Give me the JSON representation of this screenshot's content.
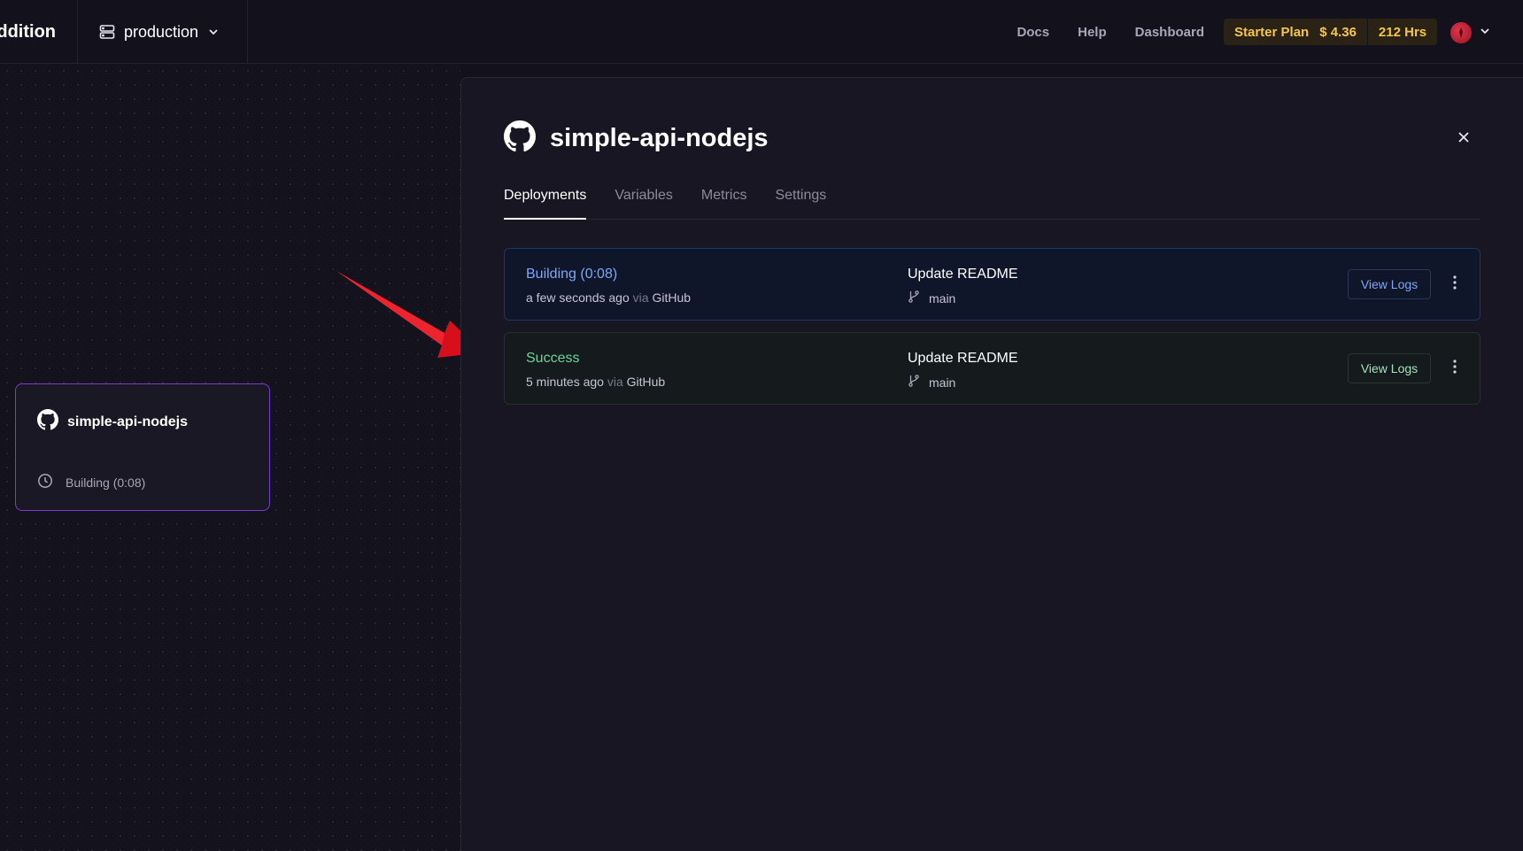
{
  "topbar": {
    "project_name": "addition",
    "environment": "production",
    "nav": [
      "Docs",
      "Help",
      "Dashboard"
    ],
    "plan": {
      "name": "Starter Plan",
      "cost": "$ 4.36",
      "hours": "212 Hrs",
      "color": "#f5c64a"
    }
  },
  "canvas": {
    "service": {
      "name": "simple-api-nodejs",
      "status": "Building (0:08)",
      "icon": "github-icon",
      "border_color": "#7b3bd0"
    },
    "arrow_color": "#e0101a"
  },
  "panel": {
    "title": "simple-api-nodejs",
    "icon": "github-icon",
    "tabs": [
      {
        "label": "Deployments",
        "active": true
      },
      {
        "label": "Variables",
        "active": false
      },
      {
        "label": "Metrics",
        "active": false
      },
      {
        "label": "Settings",
        "active": false
      }
    ],
    "deployments": [
      {
        "status": "Building (0:08)",
        "time": "a few seconds ago",
        "via": "via",
        "source": "GitHub",
        "commit": "Update README",
        "branch": "main",
        "logs_label": "View Logs",
        "status_color": "#7ea6f5"
      },
      {
        "status": "Success",
        "time": "5 minutes ago",
        "via": "via",
        "source": "GitHub",
        "commit": "Update README",
        "branch": "main",
        "logs_label": "View Logs",
        "status_color": "#6fd49a"
      }
    ]
  }
}
